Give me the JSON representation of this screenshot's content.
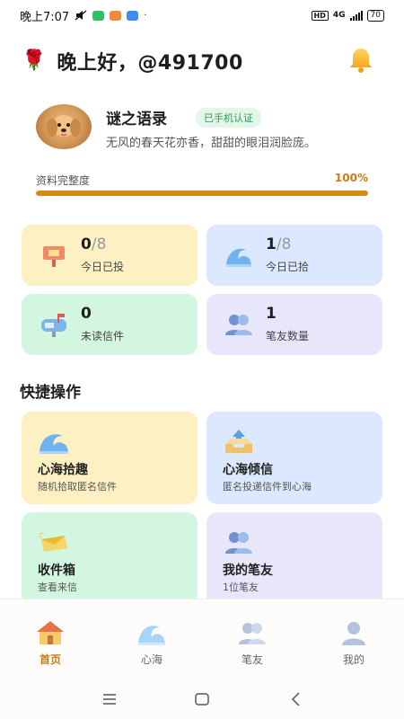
{
  "status_bar": {
    "time": "晚上7:07",
    "network": "4G",
    "battery": "70",
    "hd": "HD",
    "icons": [
      "mute-icon",
      "wechat-icon",
      "mail-icon",
      "gallery-icon",
      "signal-icon",
      "battery-icon"
    ]
  },
  "header": {
    "greeting": "晚上好，@491700",
    "rose_glyph": "🌹",
    "icons": [
      "rose-icon",
      "bell-icon"
    ]
  },
  "profile": {
    "name": "谜之语录",
    "verified_badge": "已手机认证",
    "signature": "无风的春天花亦香，甜甜的眼泪润脸庞。",
    "completeness_label": "资料完整度",
    "completeness_value": "100%",
    "completeness_fraction": 1.0
  },
  "stats": [
    {
      "num": "0",
      "den": "/8",
      "label": "今日已投",
      "icon": "mailbox-icon"
    },
    {
      "num": "1",
      "den": "/8",
      "label": "今日已拾",
      "icon": "wave-icon"
    },
    {
      "num": "0",
      "den": "",
      "label": "未读信件",
      "icon": "mailbox-flag-icon"
    },
    {
      "num": "1",
      "den": "",
      "label": "笔友数量",
      "icon": "friends-icon"
    }
  ],
  "quick_actions": {
    "title": "快捷操作",
    "items": [
      {
        "title": "心海拾趣",
        "desc": "随机拾取匿名信件",
        "icon": "wave-icon"
      },
      {
        "title": "心海倾信",
        "desc": "匿名投递信件到心海",
        "icon": "upload-tray-icon"
      },
      {
        "title": "收件箱",
        "desc": "查看来信",
        "icon": "envelope-icon"
      },
      {
        "title": "我的笔友",
        "desc": "1位笔友",
        "icon": "friends-icon"
      }
    ]
  },
  "tabbar": {
    "tabs": [
      {
        "label": "首页",
        "icon": "home-icon",
        "active": true
      },
      {
        "label": "心海",
        "icon": "wave-icon",
        "active": false
      },
      {
        "label": "笔友",
        "icon": "friends-icon",
        "active": false
      },
      {
        "label": "我的",
        "icon": "user-icon",
        "active": false
      }
    ]
  },
  "colors": {
    "accent": "#d68a16",
    "card_yellow": "#fdf0c2",
    "card_blue": "#dbe8fd",
    "card_green": "#d3f6e0",
    "card_purple": "#e8e6fb",
    "verified_green": "#2a9d56"
  }
}
